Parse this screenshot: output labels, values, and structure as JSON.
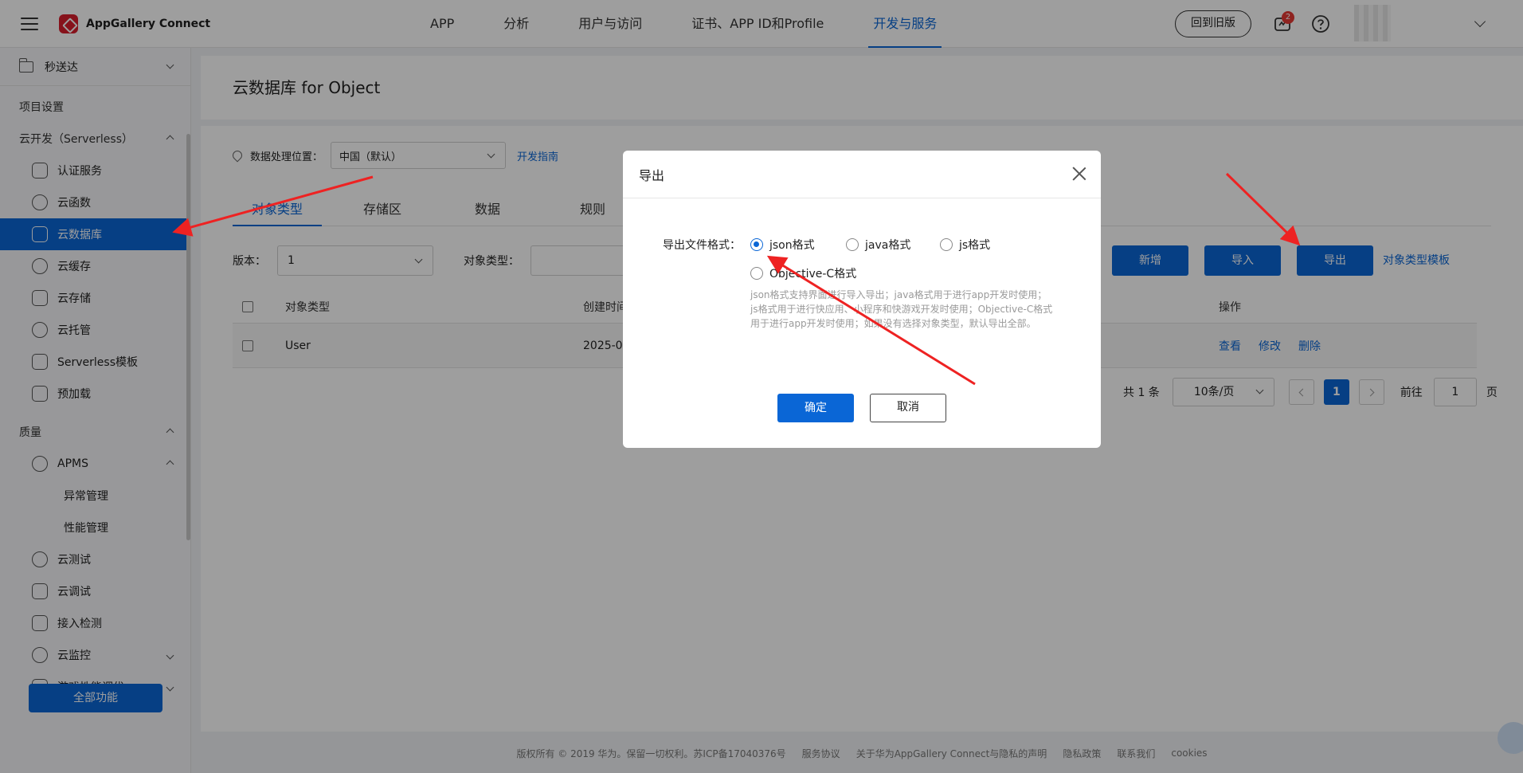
{
  "header": {
    "app_name": "AppGallery Connect",
    "nav": [
      "APP",
      "分析",
      "用户与访问",
      "证书、APP ID和Profile",
      "开发与服务"
    ],
    "active_nav": "开发与服务",
    "old_version": "回到旧版",
    "notification_count": "2"
  },
  "sidebar": {
    "project": "秒送达",
    "project_settings": "项目设置",
    "group_serverless": "云开发（Serverless）",
    "serverless_items": [
      "认证服务",
      "云函数",
      "云数据库",
      "云缓存",
      "云存储",
      "云托管",
      "Serverless模板",
      "预加载"
    ],
    "group_quality": "质量",
    "apms": "APMS",
    "apms_sub": [
      "异常管理",
      "性能管理"
    ],
    "quality_items": [
      "云测试",
      "云调试",
      "接入检测",
      "云监控",
      "游戏性能调优"
    ],
    "all_functions": "全部功能"
  },
  "main": {
    "title": "云数据库 for Object",
    "location_label": "数据处理位置：",
    "location_value": "中国（默认）",
    "guide_link": "开发指南",
    "tabs": [
      "对象类型",
      "存储区",
      "数据",
      "规则"
    ],
    "version_label": "版本：",
    "version_value": "1",
    "object_type_label": "对象类型：",
    "buttons": {
      "add": "新增",
      "import": "导入",
      "export": "导出"
    },
    "template_link": "对象类型模板",
    "table": {
      "headers": {
        "name": "对象类型",
        "created": "创建时间",
        "ops": "操作"
      },
      "rows": [
        {
          "name": "User",
          "created": "2025-0"
        }
      ],
      "op_links": [
        "查看",
        "修改",
        "删除"
      ]
    },
    "pager": {
      "total": "共 1 条",
      "page_size": "10条/页",
      "current": "1",
      "goto_label": "前往",
      "goto_value": "1",
      "page_suffix": "页"
    }
  },
  "footer": {
    "items": [
      "版权所有 © 2019 华为。保留一切权利。苏ICP备17040376号",
      "服务协议",
      "关于华为AppGallery Connect与隐私的声明",
      "隐私政策",
      "联系我们",
      "cookies"
    ]
  },
  "modal": {
    "title": "导出",
    "format_label": "导出文件格式：",
    "options": [
      "json格式",
      "java格式",
      "js格式",
      "Objective-C格式"
    ],
    "selected": "json格式",
    "hint": "json格式支持界面进行导入导出；java格式用于进行app开发时使用；js格式用于进行快应用、小程序和快游戏开发时使用；Objective-C格式用于进行app开发时使用；如果没有选择对象类型，默认导出全部。",
    "ok": "确定",
    "cancel": "取消"
  },
  "colors": {
    "brand": "#0a66d6",
    "logo": "#d81e2c",
    "arrow": "#ee2222"
  }
}
